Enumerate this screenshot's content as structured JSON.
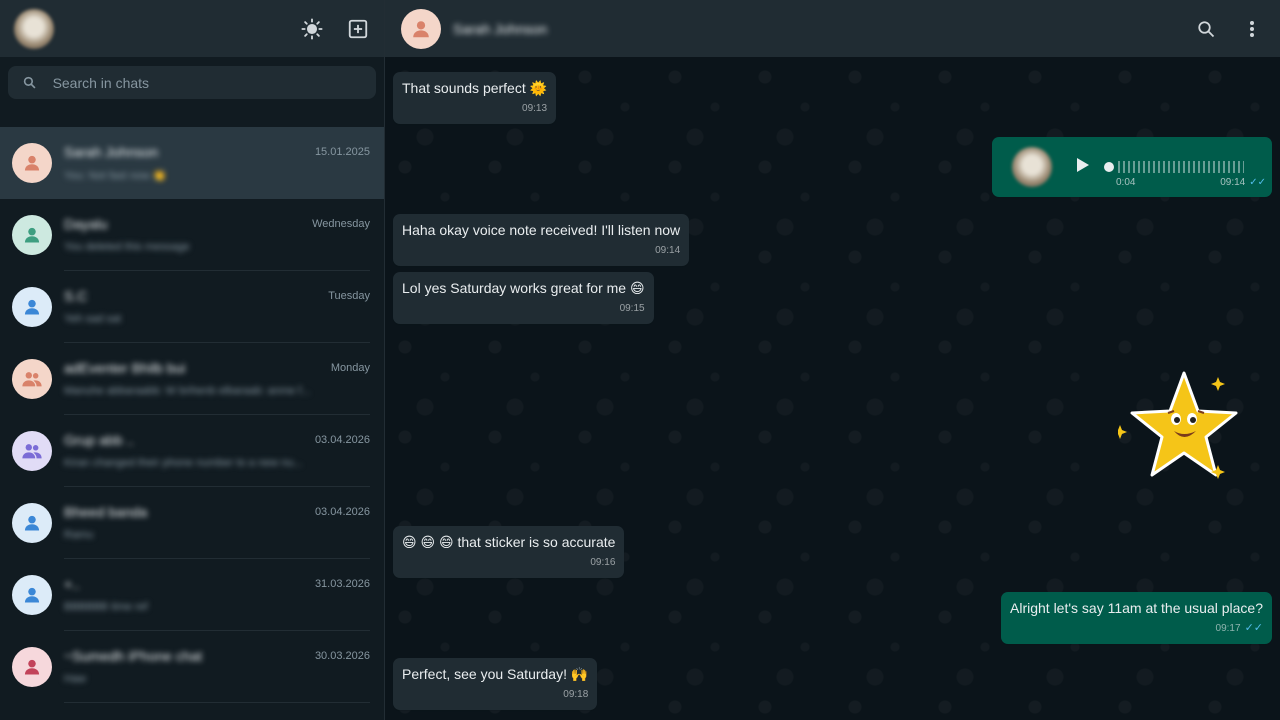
{
  "sidebar": {
    "search_placeholder": "Search in chats",
    "chats": [
      {
        "name": "Sarah Johnson",
        "time": "15.01.2025",
        "preview": "You: Not fast now 👏",
        "avatar_color": "#f4d6c9",
        "icon_color": "#d9826a",
        "icon": "person-icon"
      },
      {
        "name": "Dayalu",
        "time": "Wednesday",
        "preview": "You deleted this message",
        "avatar_color": "#cde9e0",
        "icon_color": "#3d9e80",
        "icon": "person-icon"
      },
      {
        "name": "S.C",
        "time": "Tuesday",
        "preview": "Yeh sad sat",
        "avatar_color": "#dcebf8",
        "icon_color": "#3b87d6",
        "icon": "person-icon"
      },
      {
        "name": "adEventer Bhilb bui",
        "time": "Monday",
        "preview": "Manuhe abbaraabb: W brihenb elbaraab: anme f...",
        "avatar_color": "#f4d6c9",
        "icon_color": "#d9826a",
        "icon": "group-icon"
      },
      {
        "name": "Grup abb ..",
        "time": "03.04.2026",
        "preview": "Kiran changed their phone number to a new nu...",
        "avatar_color": "#e1dcf6",
        "icon_color": "#7b6cd6",
        "icon": "group-icon"
      },
      {
        "name": "Bheed banda",
        "time": "03.04.2026",
        "preview": "Ramu",
        "avatar_color": "#dcebf8",
        "icon_color": "#3b87d6",
        "icon": "person-icon"
      },
      {
        "name": "+..",
        "time": "31.03.2026",
        "preview": "BBBBBB time ref",
        "avatar_color": "#dcebf8",
        "icon_color": "#3b87d6",
        "icon": "person-icon"
      },
      {
        "name": "~Sumedh iPhone chat",
        "time": "30.03.2026",
        "preview": "Haw",
        "avatar_color": "#f6d8dc",
        "icon_color": "#c2435a",
        "icon": "person-icon"
      }
    ]
  },
  "header": {
    "contact_name": "Sarah Johnson"
  },
  "messages": [
    {
      "text": "That sounds perfect 🌞",
      "time": "09:13"
    },
    {
      "voice_duration": "0:04",
      "time": "09:14",
      "voice_progress": 0
    },
    {
      "text": "Haha okay voice note received! I'll listen now",
      "time": "09:14"
    },
    {
      "text": "Lol yes Saturday works great for me 😄",
      "time": "09:15"
    },
    {
      "text": "😄 😄 😄  that sticker is so accurate",
      "time": "09:16"
    },
    {
      "text": "Alright let's say 11am at the usual place?",
      "time": "09:17"
    },
    {
      "text": "Perfect, see you Saturday! 🙌",
      "time": "09:18"
    }
  ],
  "colors": {
    "incoming_bubble": "#202c33",
    "outgoing_bubble": "#005c4b",
    "read_ticks": "#53bdeb"
  }
}
